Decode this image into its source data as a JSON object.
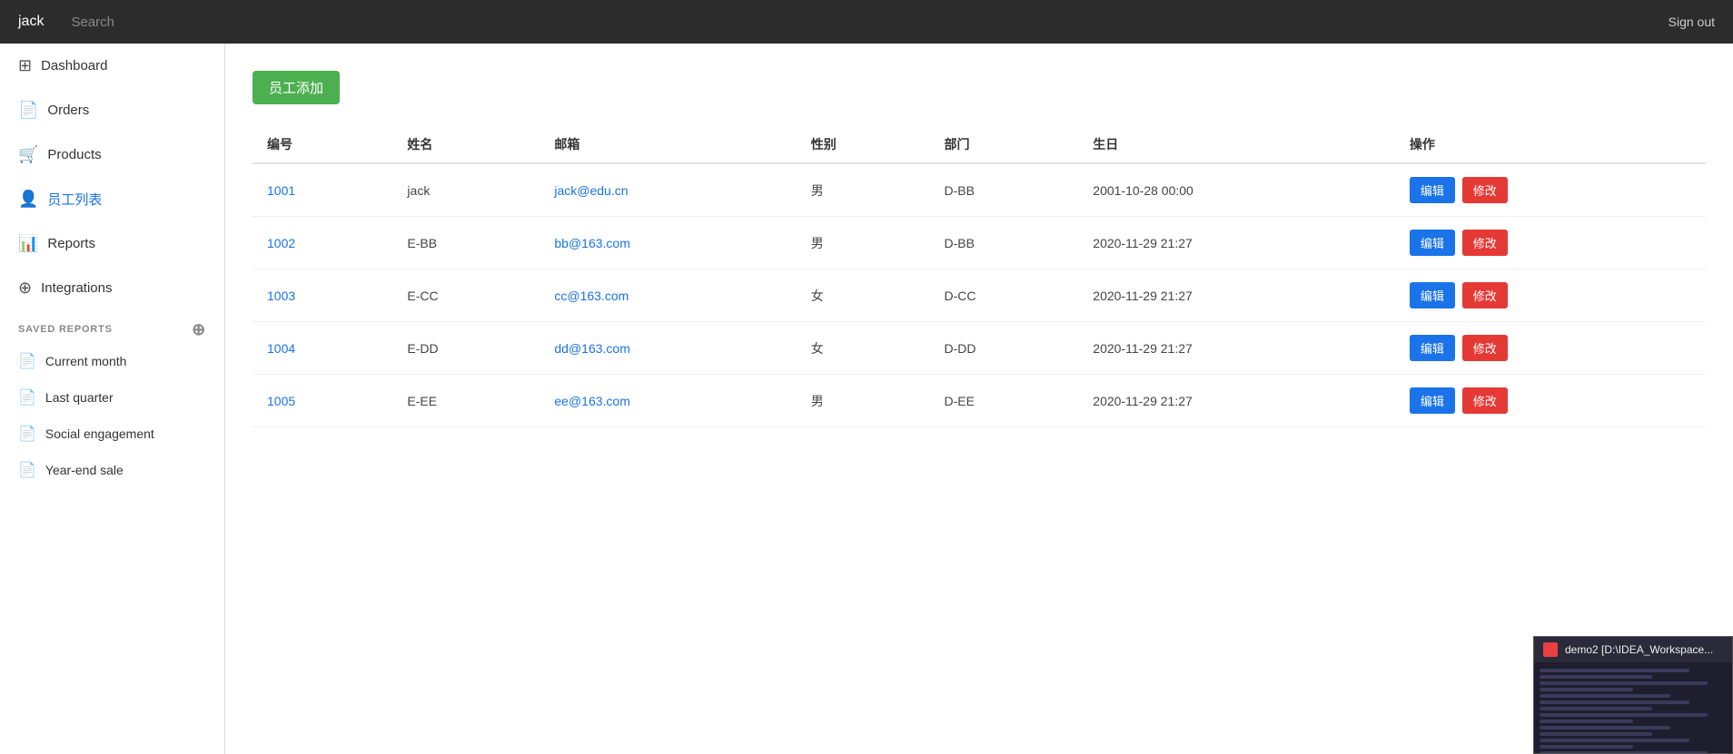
{
  "topbar": {
    "username": "jack",
    "search_placeholder": "Search",
    "signout_label": "Sign out"
  },
  "sidebar": {
    "nav_items": [
      {
        "id": "dashboard",
        "label": "Dashboard",
        "icon": "⊞",
        "active": false
      },
      {
        "id": "orders",
        "label": "Orders",
        "icon": "📄",
        "active": false
      },
      {
        "id": "products",
        "label": "Products",
        "icon": "🛒",
        "active": false
      },
      {
        "id": "employee-list",
        "label": "员工列表",
        "icon": "👤",
        "active": true
      },
      {
        "id": "reports",
        "label": "Reports",
        "icon": "📊",
        "active": false
      },
      {
        "id": "integrations",
        "label": "Integrations",
        "icon": "⊕",
        "active": false
      }
    ],
    "saved_reports_label": "SAVED REPORTS",
    "saved_reports": [
      {
        "id": "current-month",
        "label": "Current month"
      },
      {
        "id": "last-quarter",
        "label": "Last quarter"
      },
      {
        "id": "social-engagement",
        "label": "Social engagement"
      },
      {
        "id": "year-end-sale",
        "label": "Year-end sale"
      }
    ]
  },
  "main": {
    "add_button_label": "员工添加",
    "table": {
      "headers": [
        "编号",
        "姓名",
        "邮箱",
        "性别",
        "部门",
        "生日",
        "操作"
      ],
      "rows": [
        {
          "id": "1001",
          "name": "jack",
          "email": "jack@edu.cn",
          "gender": "男",
          "dept": "D-BB",
          "birthday": "2001-10-28 00:00"
        },
        {
          "id": "1002",
          "name": "E-BB",
          "email": "bb@163.com",
          "gender": "男",
          "dept": "D-BB",
          "birthday": "2020-11-29 21:27"
        },
        {
          "id": "1003",
          "name": "E-CC",
          "email": "cc@163.com",
          "gender": "女",
          "dept": "D-CC",
          "birthday": "2020-11-29 21:27"
        },
        {
          "id": "1004",
          "name": "E-DD",
          "email": "dd@163.com",
          "gender": "女",
          "dept": "D-DD",
          "birthday": "2020-11-29 21:27"
        },
        {
          "id": "1005",
          "name": "E-EE",
          "email": "ee@163.com",
          "gender": "男",
          "dept": "D-EE",
          "birthday": "2020-11-29 21:27"
        }
      ],
      "edit_label": "编辑",
      "modify_label": "修改"
    }
  },
  "taskbar_preview": {
    "title": "demo2 [D:\\IDEA_Workspace..."
  }
}
